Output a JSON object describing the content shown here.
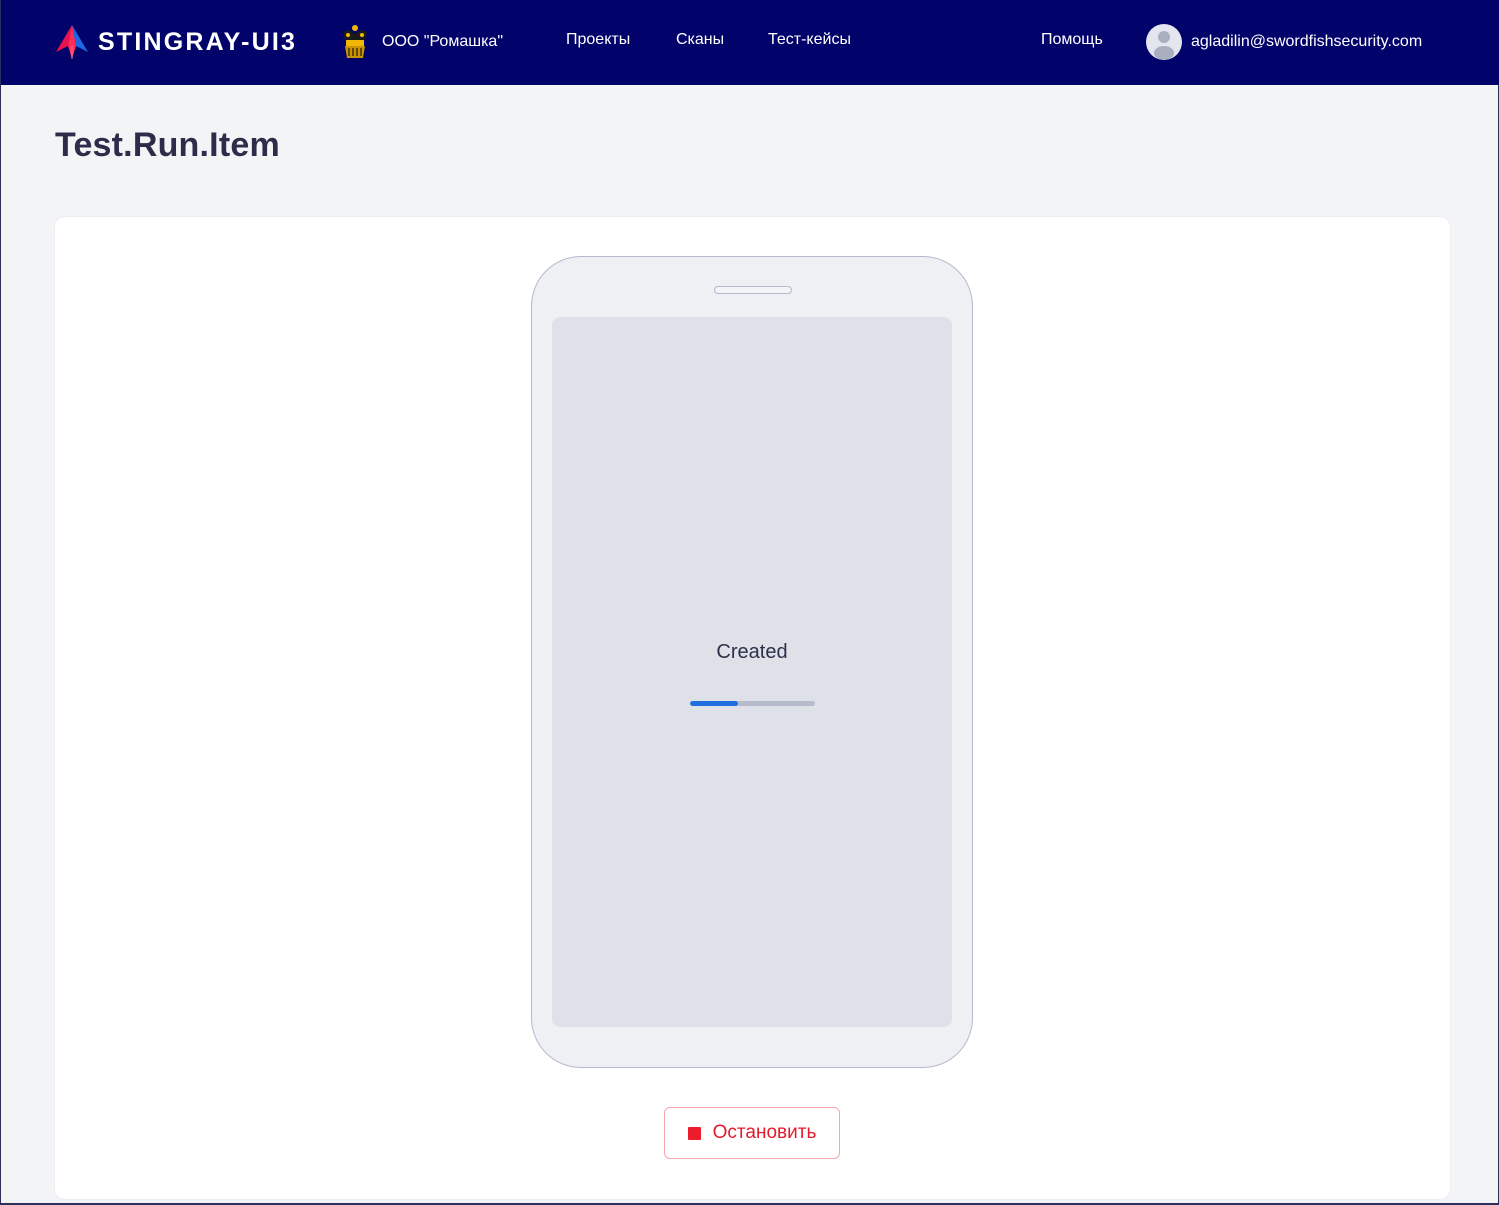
{
  "header": {
    "brand_name": "STINGRAY-UI3",
    "brand_logo_icon": "stingray-logo-icon",
    "organization_name": "ООО \"Ромашка\"",
    "organization_icon": "coat-of-arms-icon",
    "nav": [
      {
        "label": "Проекты"
      },
      {
        "label": "Сканы"
      },
      {
        "label": "Тест-кейсы"
      }
    ],
    "help_label": "Помощь",
    "user_email": "agladilin@swordfishsecurity.com",
    "avatar_icon": "user-avatar-icon"
  },
  "page": {
    "title": "Test.Run.Item"
  },
  "device_preview": {
    "status": "Created",
    "progress_fraction": 0.38
  },
  "actions": {
    "stop_label": "Остановить",
    "stop_icon": "stop-square-icon"
  },
  "colors": {
    "header_background": "#02026b",
    "page_background": "#f3f4f6",
    "accent_blue": "#1f6fe0",
    "danger_red": "#e5192b"
  }
}
